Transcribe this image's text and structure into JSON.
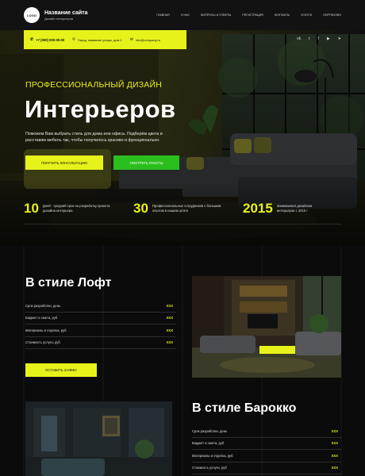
{
  "header": {
    "logo": "LOGO",
    "site_name": "Название сайта",
    "site_sub": "Дизайн интерьеров",
    "nav": [
      "Главная",
      "О нас",
      "Вопросы и ответы",
      "Регистрация",
      "Контакты",
      "Услуги",
      "Портфолио"
    ]
  },
  "contact": {
    "phone": "+7 (000) 000-00-00",
    "address": "Город, название улицы, дом 1",
    "email": "info@company.ru"
  },
  "socials": [
    "vk",
    "twitter",
    "facebook",
    "youtube",
    "telegram"
  ],
  "hero": {
    "eyebrow": "Профессиональный дизайн",
    "title": "Интерьеров",
    "description": "Поможем Вам выбрать стиль для дома или офиса. Подберём цвета и расставим мебель так, чтобы получилось красиво и функционально.",
    "btn_primary": "Получить консультацию",
    "btn_secondary": "Смотреть работы",
    "stats": [
      {
        "num": "10",
        "text": "Дней - средний срок на разработку проекта дизайна интерьера"
      },
      {
        "num": "30",
        "text": "Профессиональных сотрудников с большим опытом в нашем штате"
      },
      {
        "num": "2015",
        "text": "Занимаемся дизайном интерьеров с 2015 г"
      }
    ]
  },
  "loft": {
    "title": "В стиле Лофт",
    "rows": [
      {
        "label": "Срок разработки, день",
        "value": "XXX"
      },
      {
        "label": "Бюджет и смета, руб",
        "value": "XXX"
      },
      {
        "label": "Материалы и отделка, руб",
        "value": "XXX"
      },
      {
        "label": "Стоимость услуги, руб",
        "value": "XXX"
      }
    ],
    "button": "Оставить заявку"
  },
  "baroque": {
    "title": "В стиле Барокко",
    "rows": [
      {
        "label": "Срок разработки, день",
        "value": "XXX"
      },
      {
        "label": "Бюджет и смета, руб",
        "value": "XXX"
      },
      {
        "label": "Материалы и отделка, руб",
        "value": "XXX"
      },
      {
        "label": "Стоимость услуги, руб",
        "value": "XXX"
      }
    ]
  },
  "colors": {
    "accent": "#e7f21b",
    "green": "#2bbf1e",
    "bg": "#0b0b0c"
  }
}
